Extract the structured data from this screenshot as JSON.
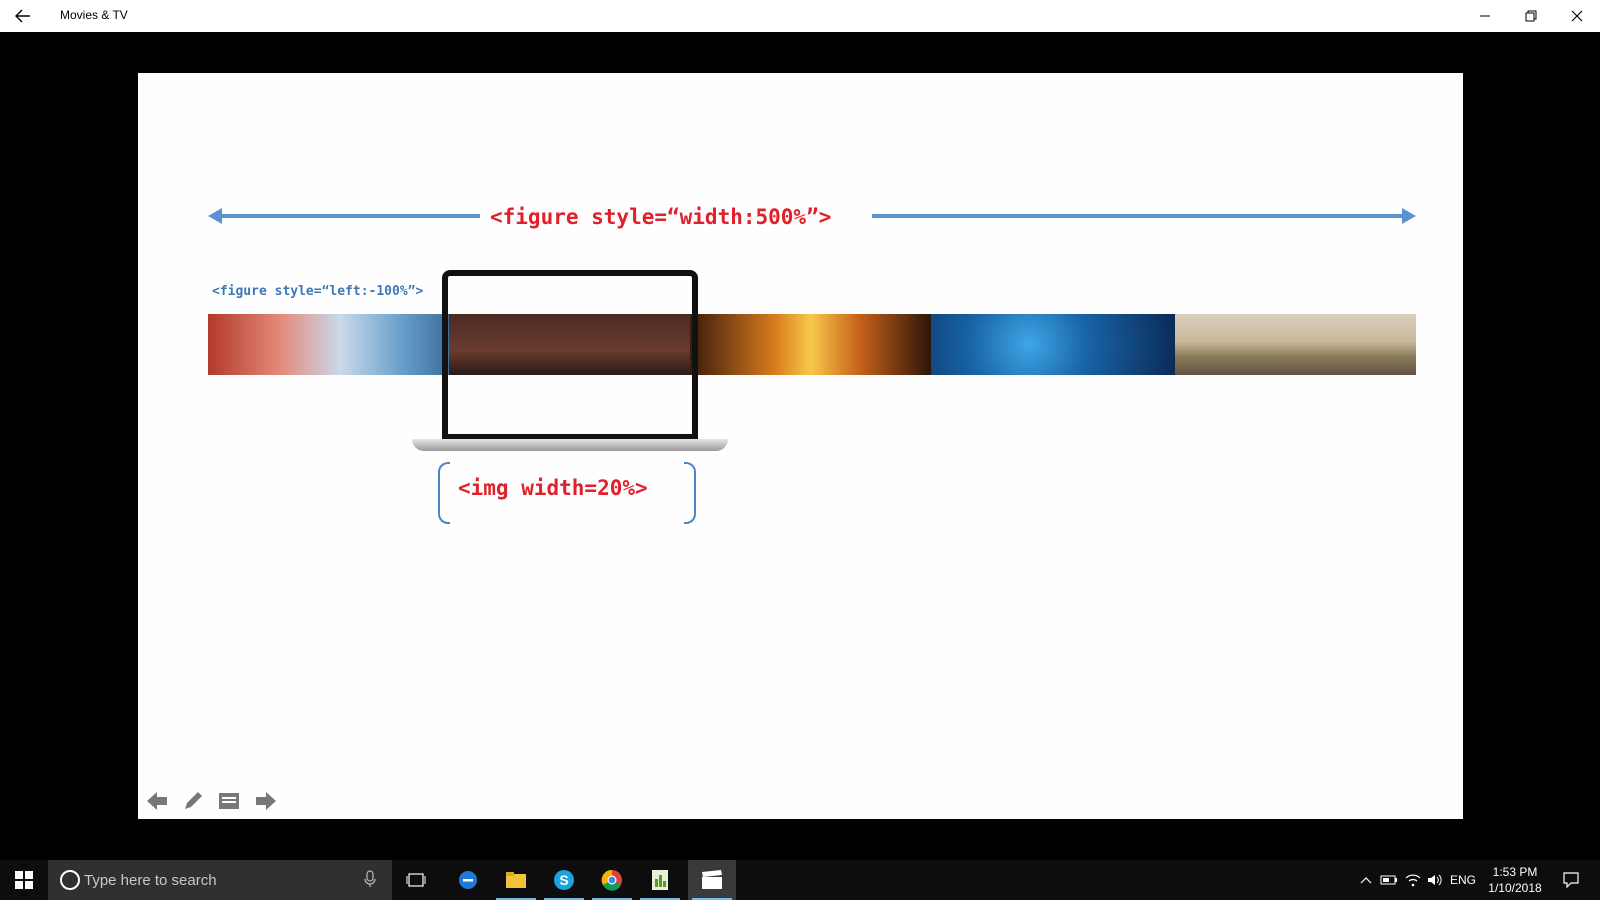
{
  "window": {
    "title": "Movies & TV"
  },
  "slide": {
    "figure_width_label": "<figure style=“width:500%”>",
    "figure_left_label": "<figure style=“left:-100%”>",
    "img_width_label": "<img width=20%>"
  },
  "colors": {
    "label_red": "#e0202a",
    "arrow_blue": "#5b93cf",
    "taskbar_accent": "#76b9ed"
  },
  "taskbar": {
    "search_placeholder": "Type here to search",
    "language": "ENG",
    "time": "1:53 PM",
    "date": "1/10/2018",
    "apps": [
      "task-view",
      "edge",
      "file-explorer",
      "skype",
      "chrome",
      "gnumeric",
      "movies-tv"
    ]
  }
}
